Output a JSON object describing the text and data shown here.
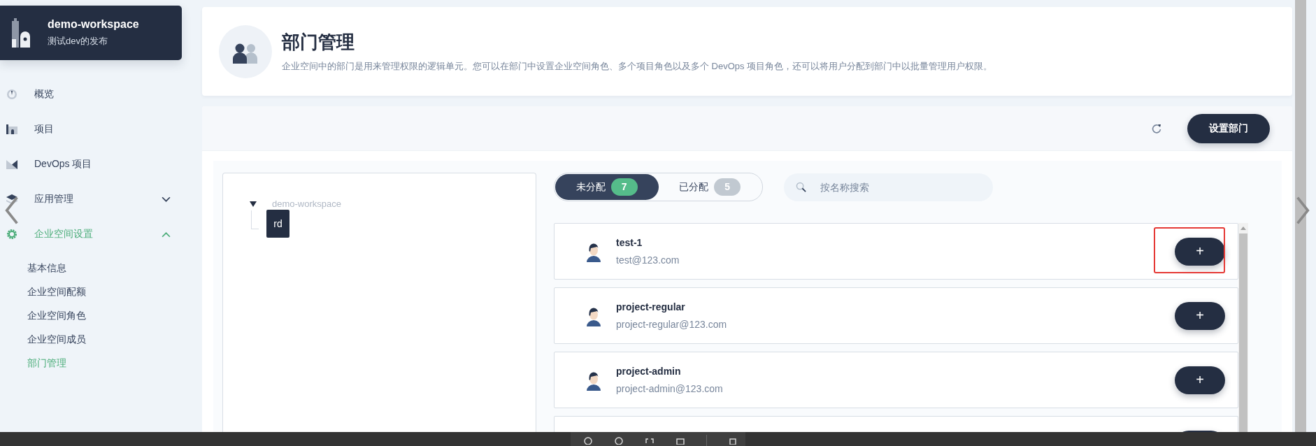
{
  "workspace": {
    "name": "demo-workspace",
    "subtitle": "测试dev的发布"
  },
  "nav": [
    {
      "kind": "overview",
      "label": "概览",
      "active": false
    },
    {
      "kind": "project",
      "label": "项目",
      "active": false
    },
    {
      "kind": "devops",
      "label": "DevOps 项目",
      "active": false
    },
    {
      "kind": "apps",
      "label": "应用管理",
      "active": false,
      "expanded": false
    },
    {
      "kind": "settings",
      "label": "企业空间设置",
      "active": true,
      "expanded": true,
      "children": [
        {
          "label": "基本信息",
          "selected": false
        },
        {
          "label": "企业空间配额",
          "selected": false
        },
        {
          "label": "企业空间角色",
          "selected": false
        },
        {
          "label": "企业空间成员",
          "selected": false
        },
        {
          "label": "部门管理",
          "selected": true
        }
      ]
    }
  ],
  "header": {
    "title": "部门管理",
    "description": "企业空间中的部门是用来管理权限的逻辑单元。您可以在部门中设置企业空间角色、多个项目角色以及多个 DevOps 项目角色，还可以将用户分配到部门中以批量管理用户权限。"
  },
  "toolbar": {
    "button": "设置部门"
  },
  "tree": {
    "label": "demo-workspace",
    "expanded": true,
    "children": [
      {
        "label": "rd",
        "selected": true
      }
    ]
  },
  "tabs": [
    {
      "label": "未分配",
      "count": "7",
      "selected": true
    },
    {
      "label": "已分配",
      "count": "5",
      "selected": false
    }
  ],
  "search": {
    "placeholder": "按名称搜索"
  },
  "members": [
    {
      "name": "test-1",
      "email": "test@123.com",
      "button": "+",
      "highlighted": true
    },
    {
      "name": "project-regular",
      "email": "project-regular@123.com",
      "button": "+",
      "highlighted": false
    },
    {
      "name": "project-admin",
      "email": "project-admin@123.com",
      "button": "+",
      "highlighted": false
    }
  ]
}
